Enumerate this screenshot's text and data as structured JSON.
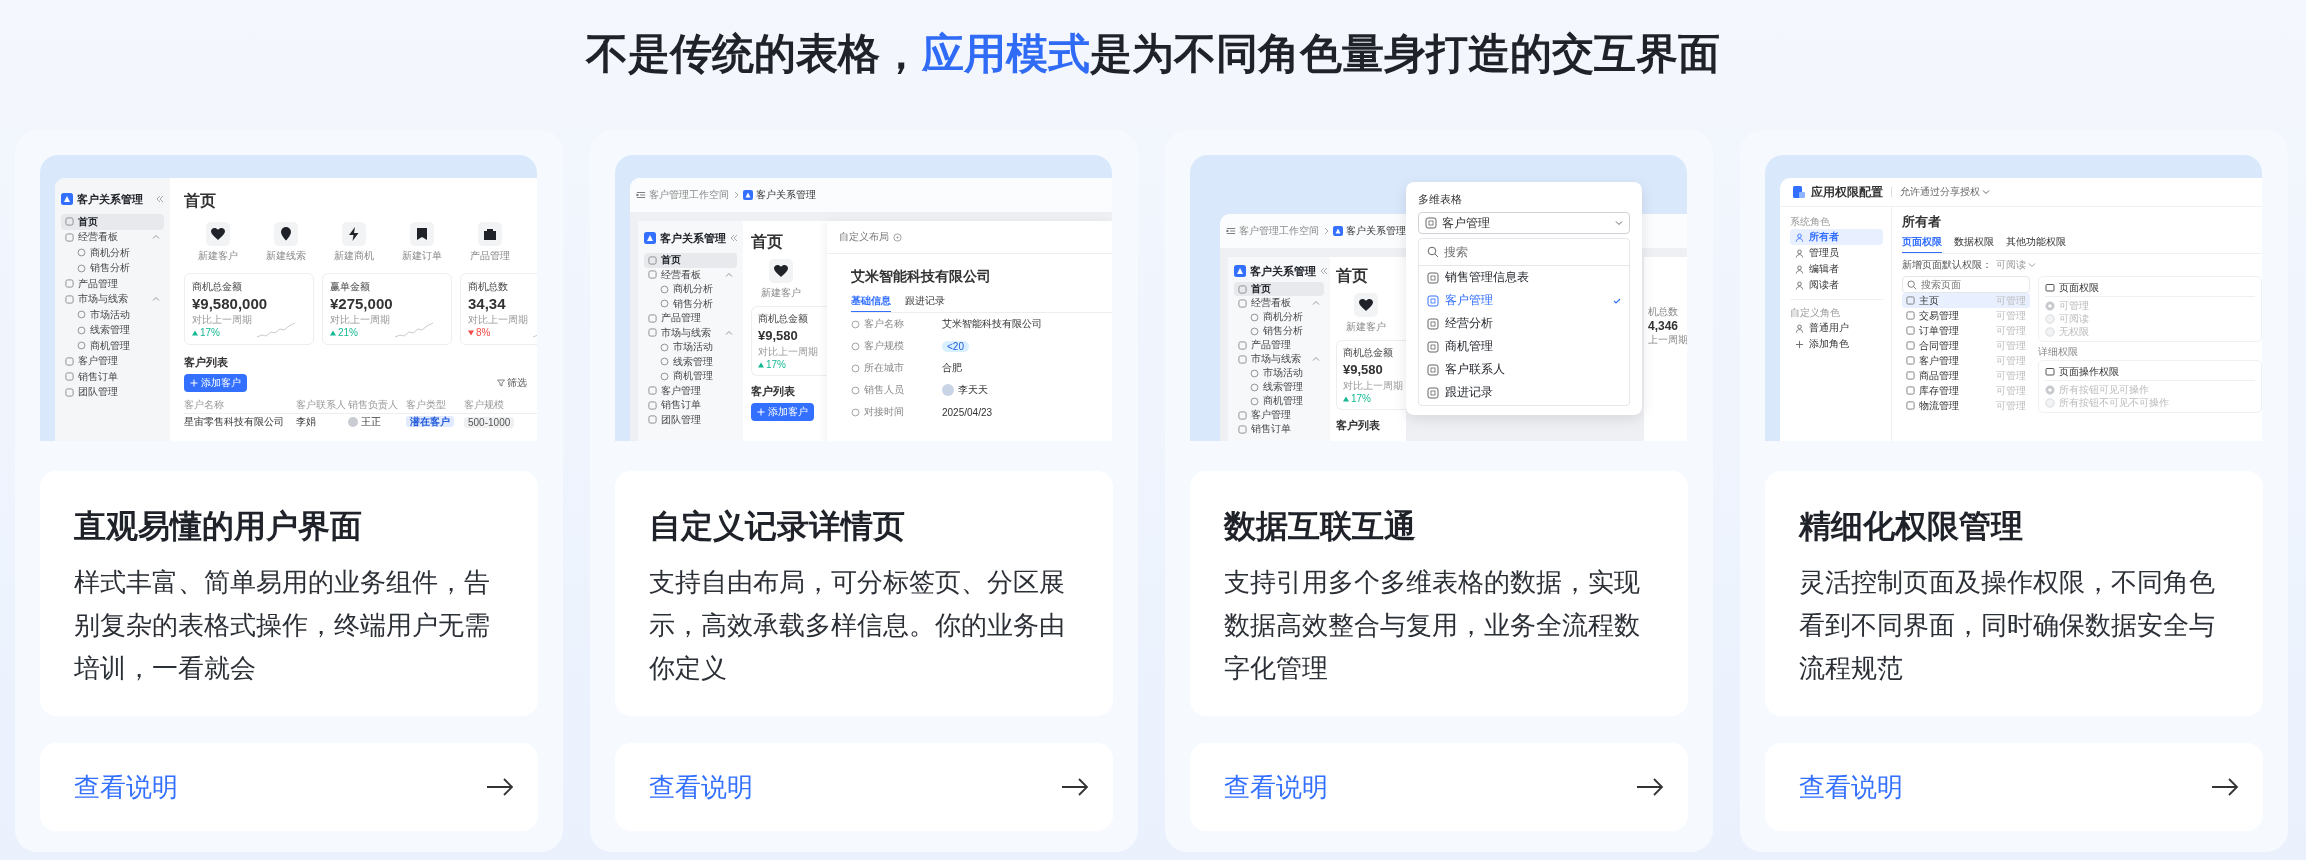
{
  "heading": {
    "before": "不是传统的表格，",
    "highlight": "应用模式",
    "after": "是为不同角色量身打造的交互界面"
  },
  "cards": [
    {
      "kind": "dashboard",
      "title": "直观易懂的用户界面",
      "description": "样式丰富、简单易用的业务组件，告别复杂的表格式操作，终端用户无需培训，一看就会",
      "link": "查看说明",
      "preview": {
        "sidebar": {
          "app_name": "客户关系管理",
          "items": [
            {
              "label": "首页",
              "selected": true
            },
            {
              "label": "经营看板",
              "selected": false,
              "expanded": true,
              "children": [
                {
                  "label": "商机分析",
                  "selected": false
                },
                {
                  "label": "销售分析",
                  "selected": false
                }
              ]
            },
            {
              "label": "产品管理",
              "selected": false
            },
            {
              "label": "市场与线索",
              "selected": false,
              "expanded": true,
              "children": [
                {
                  "label": "市场活动",
                  "selected": false
                },
                {
                  "label": "线索管理",
                  "selected": false
                },
                {
                  "label": "商机管理",
                  "selected": false
                }
              ]
            },
            {
              "label": "客户管理",
              "selected": false
            },
            {
              "label": "销售订单",
              "selected": false
            },
            {
              "label": "团队管理",
              "selected": false
            }
          ]
        },
        "page_title": "首页",
        "actions": [
          "新建客户",
          "新建线索",
          "新建商机",
          "新建订单",
          "产品管理"
        ],
        "stats": [
          {
            "label": "商机总金额",
            "value": "¥9,580,000",
            "compare": "对比上一周期",
            "change": "17%",
            "rising": true
          },
          {
            "label": "赢单金额",
            "value": "¥275,000",
            "compare": "对比上一周期",
            "change": "21%",
            "rising": true
          },
          {
            "label": "商机总数",
            "value": "34,34",
            "compare": "对比上一周期",
            "change": "8%",
            "rising": false
          }
        ],
        "list": {
          "title": "客户列表",
          "add_button": "添加客户",
          "filter": "筛选",
          "columns": [
            "客户名称",
            "客户联系人",
            "销售负责人",
            "客户类型",
            "客户规模"
          ],
          "rows": [
            [
              "星宙零售科技有限公司",
              "李娟",
              "王正",
              "潜在客户",
              "500-1000"
            ]
          ]
        }
      }
    },
    {
      "kind": "detail",
      "title": "自定义记录详情页",
      "description": "支持自由布局，可分标签页、分区展示，高效承载多样信息。你的业务由你定义",
      "link": "查看说明",
      "preview": {
        "breadcrumb": [
          "客户管理工作空间",
          "客户关系管理"
        ],
        "sidebar": {
          "app_name": "客户关系管理",
          "items": [
            {
              "label": "首页",
              "selected": true
            },
            {
              "label": "经营看板",
              "selected": false,
              "expanded": true,
              "children": [
                {
                  "label": "商机分析",
                  "selected": false
                },
                {
                  "label": "销售分析",
                  "selected": false
                }
              ]
            },
            {
              "label": "产品管理",
              "selected": false
            },
            {
              "label": "市场与线索",
              "selected": false,
              "expanded": true,
              "children": [
                {
                  "label": "市场活动",
                  "selected": false
                },
                {
                  "label": "线索管理",
                  "selected": false
                },
                {
                  "label": "商机管理",
                  "selected": false
                }
              ]
            },
            {
              "label": "客户管理",
              "selected": false
            },
            {
              "label": "销售订单",
              "selected": false
            },
            {
              "label": "团队管理",
              "selected": false
            }
          ]
        },
        "page_title": "首页",
        "actions": [
          "新建客户"
        ],
        "stats": [
          {
            "label": "商机总金额",
            "value": "¥9,580",
            "compare": "对比上一周期",
            "change": "17%",
            "rising": true
          }
        ],
        "list": {
          "title": "客户列表",
          "add_button": "添加客户"
        },
        "record": {
          "layout_label": "自定义布局",
          "name": "艾米智能科技有限公司",
          "tabs": [
            {
              "label": "基础信息",
              "selected": true
            },
            {
              "label": "跟进记录",
              "selected": false
            }
          ],
          "fields": [
            {
              "label": "客户名称",
              "value": "艾米智能科技有限公司",
              "kind": "text"
            },
            {
              "label": "客户规模",
              "value": "<20",
              "kind": "tag"
            },
            {
              "label": "所在城市",
              "value": "合肥",
              "kind": "text"
            },
            {
              "label": "销售人员",
              "value": "李天天",
              "kind": "person"
            },
            {
              "label": "对接时间",
              "value": "2025/04/23",
              "kind": "text"
            }
          ]
        }
      }
    },
    {
      "kind": "picker",
      "title": "数据互联互通",
      "description": "支持引用多个多维表格的数据，实现数据高效整合与复用，业务全流程数字化管理",
      "link": "查看说明",
      "preview": {
        "breadcrumb": [
          "客户管理工作空间",
          "客户关系管理"
        ],
        "sidebar": {
          "app_name": "客户关系管理",
          "items": [
            {
              "label": "首页",
              "selected": true
            },
            {
              "label": "经营看板",
              "selected": false,
              "expanded": true,
              "children": [
                {
                  "label": "商机分析",
                  "selected": false
                },
                {
                  "label": "销售分析",
                  "selected": false
                }
              ]
            },
            {
              "label": "产品管理",
              "selected": false
            },
            {
              "label": "市场与线索",
              "selected": false,
              "expanded": true,
              "children": [
                {
                  "label": "市场活动",
                  "selected": false
                },
                {
                  "label": "线索管理",
                  "selected": false
                },
                {
                  "label": "商机管理",
                  "selected": false
                }
              ]
            },
            {
              "label": "客户管理",
              "selected": false
            },
            {
              "label": "销售订单",
              "selected": false
            }
          ]
        },
        "page_title": "首页",
        "actions": [
          "新建客户"
        ],
        "stats": [
          {
            "label": "商机总金额",
            "value": "¥9,580",
            "compare": "对比上一周期",
            "change": "17%",
            "rising": true
          }
        ],
        "list": {
          "title": "客户列表"
        },
        "side_stat": {
          "label": "机总数",
          "value": "4,346",
          "compare": "上一周期"
        },
        "picker": {
          "label": "多维表格",
          "value": "客户管理",
          "search_placeholder": "搜索",
          "options": [
            {
              "label": "销售管理信息表",
              "selected": false
            },
            {
              "label": "客户管理",
              "selected": true
            },
            {
              "label": "经营分析",
              "selected": false
            },
            {
              "label": "商机管理",
              "selected": false
            },
            {
              "label": "客户联系人",
              "selected": false
            },
            {
              "label": "跟进记录",
              "selected": false
            }
          ]
        }
      }
    },
    {
      "kind": "permissions",
      "title": "精细化权限管理",
      "description": "灵活控制页面及操作权限，不同角色看到不同界面，同时确保数据安全与流程规范",
      "link": "查看说明",
      "preview": {
        "app_title": "应用权限配置",
        "share_setting": "允许通过分享授权",
        "role_groups": [
          {
            "title": "系统角色",
            "roles": [
              {
                "label": "所有者",
                "selected": true
              },
              {
                "label": "管理员",
                "selected": false
              },
              {
                "label": "编辑者",
                "selected": false
              },
              {
                "label": "阅读者",
                "selected": false
              }
            ]
          },
          {
            "title": "自定义角色",
            "roles": [
              {
                "label": "普通用户",
                "selected": false
              }
            ]
          }
        ],
        "add_role": "添加角色",
        "role_title": "所有者",
        "tabs": [
          {
            "label": "页面权限",
            "selected": true
          },
          {
            "label": "数据权限",
            "selected": false
          },
          {
            "label": "其他功能权限",
            "selected": false
          }
        ],
        "default_label": "新增页面默认权限：",
        "default_value": "可阅读",
        "search_placeholder": "搜索页面",
        "pages": [
          {
            "label": "主页",
            "access": "可管理",
            "selected": true
          },
          {
            "label": "交易管理",
            "access": "可管理",
            "selected": false
          },
          {
            "label": "订单管理",
            "access": "可管理",
            "selected": false
          },
          {
            "label": "合同管理",
            "access": "可管理",
            "selected": false
          },
          {
            "label": "客户管理",
            "access": "可管理",
            "selected": false
          },
          {
            "label": "商品管理",
            "access": "可管理",
            "selected": false
          },
          {
            "label": "库存管理",
            "access": "可管理",
            "selected": false
          },
          {
            "label": "物流管理",
            "access": "可管理",
            "selected": false
          }
        ],
        "page_panel": {
          "title": "页面权限",
          "options": [
            {
              "label": "可管理",
              "checked": true,
              "disabled": true
            },
            {
              "label": "可阅读",
              "checked": false,
              "disabled": true
            },
            {
              "label": "无权限",
              "checked": false,
              "disabled": true
            }
          ]
        },
        "detail_title": "详细权限",
        "action_panel": {
          "title": "页面操作权限",
          "options": [
            {
              "label": "所有按钮可见可操作",
              "checked": true,
              "disabled": true
            },
            {
              "label": "所有按钮不可见不可操作",
              "checked": false,
              "disabled": true
            }
          ]
        }
      }
    }
  ]
}
